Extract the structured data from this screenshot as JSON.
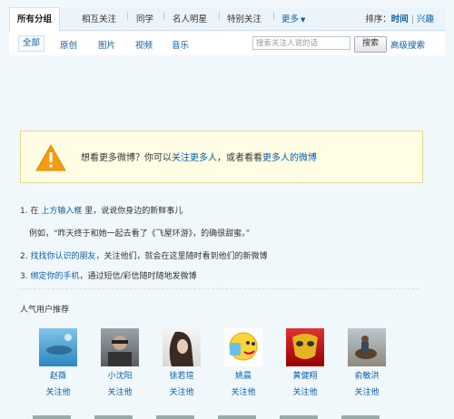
{
  "tabs": {
    "items": [
      {
        "label": "所有分组",
        "active": true
      },
      {
        "label": "相互关注"
      },
      {
        "label": "同学"
      },
      {
        "label": "名人明星"
      },
      {
        "label": "特别关注"
      },
      {
        "label": "更多"
      }
    ],
    "sort_label": "排序：",
    "sort_time": "时间",
    "sort_sep": "|",
    "sort_interest": "兴趣"
  },
  "subnav": {
    "items": [
      "全部",
      "原创",
      "图片",
      "视频",
      "音乐"
    ],
    "search_placeholder": "搜索关注人说的话",
    "search_button": "搜索",
    "advanced_search": "高级搜索"
  },
  "notice": {
    "prefix": "想看更多微博？你可以",
    "link1": "关注更多人",
    "middle": "，或者看看",
    "link2": "更多人的微博"
  },
  "tips": {
    "tip1_num": "1.",
    "tip1_pre": "在",
    "tip1_link": "上方输入框",
    "tip1_post": "里，说说你身边的新鲜事儿",
    "tip1_example": "例如，“昨天终于和她一起去看了《飞屋环游》，的确很甜蜜。”",
    "tip2_num": "2.",
    "tip2_link": "找找你认识的朋友",
    "tip2_post": "，关注他们，就会在这里随时看到他们的新微博",
    "tip3_num": "3.",
    "tip3_link": "绑定你的手机",
    "tip3_post": "，通过短信/彩信随时随地发微博"
  },
  "recommend": {
    "title": "人气用户推荐",
    "users": [
      {
        "name": "赵薇",
        "follow": "关注他"
      },
      {
        "name": "小沈阳",
        "follow": "关注他"
      },
      {
        "name": "徐若瑄",
        "follow": "关注他"
      },
      {
        "name": "姚晨",
        "follow": "关注他"
      },
      {
        "name": "黄健翔",
        "follow": "关注他"
      },
      {
        "name": "俞敏洪",
        "follow": "关注他"
      }
    ]
  },
  "colors": {
    "link": "#0a5ea8",
    "background": "#f1f8fc",
    "notice_bg": "#fffde4",
    "warning_icon": "#f39c12"
  }
}
